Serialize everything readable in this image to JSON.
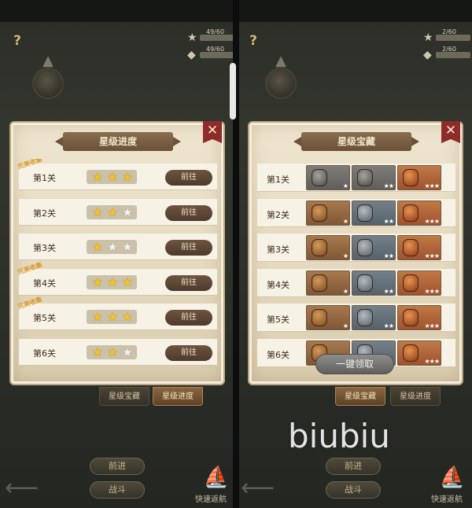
{
  "left_screen": {
    "help": "?",
    "stats": [
      {
        "icon": "star-icon",
        "text": "49/60"
      },
      {
        "icon": "bag-icon",
        "text": "49/60"
      }
    ],
    "panel": {
      "title": "星级进度",
      "close": "✕",
      "rows": [
        {
          "level": "第1关",
          "stars": 3,
          "promo": "完美收集",
          "button": "前往"
        },
        {
          "level": "第2关",
          "stars": 2,
          "promo": "",
          "button": "前往"
        },
        {
          "level": "第3关",
          "stars": 1,
          "promo": "",
          "button": "前往"
        },
        {
          "level": "第4关",
          "stars": 3,
          "promo": "完美收集",
          "button": "前往"
        },
        {
          "level": "第5关",
          "stars": 3,
          "promo": "完美收集",
          "button": "前往"
        },
        {
          "level": "第6关",
          "stars": 2,
          "promo": "",
          "button": "前往"
        }
      ]
    },
    "tabs": {
      "treasure": "星级宝藏",
      "progress": "星级进度",
      "active": "progress"
    },
    "bottom": {
      "forward": "前进",
      "battle": "战斗",
      "quick_return": "快速返航"
    }
  },
  "right_screen": {
    "help": "?",
    "stats": [
      {
        "icon": "star-icon",
        "text": "2/60"
      },
      {
        "icon": "bag-icon",
        "text": "2/60"
      }
    ],
    "panel": {
      "title": "星级宝藏",
      "close": "✕",
      "rows": [
        {
          "level": "第1关",
          "chests": [
            {
              "tier": "bronze",
              "stars": "★",
              "claimed": true
            },
            {
              "tier": "silver",
              "stars": "★★",
              "claimed": true
            },
            {
              "tier": "gold",
              "stars": "★★★",
              "claimed": false
            }
          ]
        },
        {
          "level": "第2关",
          "chests": [
            {
              "tier": "bronze",
              "stars": "★",
              "claimed": false
            },
            {
              "tier": "silver",
              "stars": "★★",
              "claimed": false
            },
            {
              "tier": "gold",
              "stars": "★★★",
              "claimed": false
            }
          ]
        },
        {
          "level": "第3关",
          "chests": [
            {
              "tier": "bronze",
              "stars": "★",
              "claimed": false
            },
            {
              "tier": "silver",
              "stars": "★★",
              "claimed": false
            },
            {
              "tier": "gold",
              "stars": "★★★",
              "claimed": false
            }
          ]
        },
        {
          "level": "第4关",
          "chests": [
            {
              "tier": "bronze",
              "stars": "★",
              "claimed": false
            },
            {
              "tier": "silver",
              "stars": "★★",
              "claimed": false
            },
            {
              "tier": "gold",
              "stars": "★★★",
              "claimed": false
            }
          ]
        },
        {
          "level": "第5关",
          "chests": [
            {
              "tier": "bronze",
              "stars": "★",
              "claimed": false
            },
            {
              "tier": "silver",
              "stars": "★★",
              "claimed": false
            },
            {
              "tier": "gold",
              "stars": "★★★",
              "claimed": false
            }
          ]
        },
        {
          "level": "第6关",
          "chests": [
            {
              "tier": "bronze",
              "stars": "★",
              "claimed": false
            },
            {
              "tier": "silver",
              "stars": "★★",
              "claimed": false
            },
            {
              "tier": "gold",
              "stars": "★★★",
              "claimed": false
            }
          ]
        }
      ],
      "claim_all": "一键领取"
    },
    "tabs": {
      "treasure": "星级宝藏",
      "progress": "星级进度",
      "active": "treasure"
    },
    "bottom": {
      "forward": "前进",
      "battle": "战斗",
      "quick_return": "快速返航"
    }
  },
  "watermark": "biubiu",
  "colors": {
    "star_on": "#f5c51f",
    "star_off": "#f3f3f3",
    "close": "#8e2b2b",
    "parchment": "#efe6d0"
  }
}
